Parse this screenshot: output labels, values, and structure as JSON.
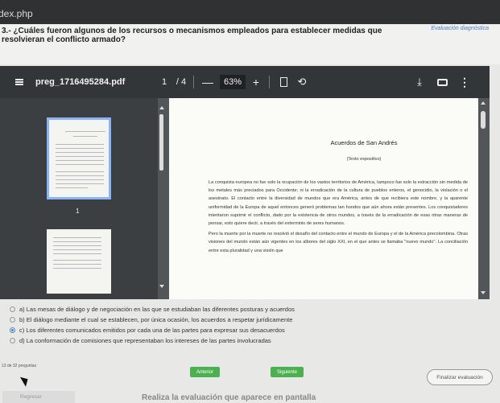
{
  "window": {
    "title": "dex.php"
  },
  "question": {
    "text": "3.- ¿Cuáles fueron algunos de los recursos o mecanismos empleados para establecer medidas que resolvieran el conflicto armado?",
    "eval_label": "Evaluación diagnóstica"
  },
  "pdf": {
    "filename": "preg_1716495284.pdf",
    "page_current": "1",
    "page_sep": "/ 4",
    "zoom": "63%",
    "zoom_minus": "—",
    "zoom_plus": "+",
    "thumb_page_number": "1",
    "doc_title": "Acuerdos de San Andrés",
    "doc_subtitle": "(Texto expositivo)",
    "paragraph1": "La conquista europea no fue solo la ocupación de los vastos territorios de América, tampoco fue solo la extracción sin medida de los metales más preciados para Occidente; ni la erradicación de la cultura de pueblos enteros, el genocidio, la violación o el asesinato. El contacto entre la diversidad de mundos que era América, antes de que recibiera este nombre, y la aparente uniformidad de la Europa de aquel entonces generó problemas tan hondos que aún ahora están presentes. Los conquistadores intentaron suprimir el conflicto, dado por la existencia de otros mundos, a través de la erradicación de esas otras maneras de pensar, esto quiere decir, a través del exterminio de seres humanos.",
    "paragraph2": "Pero la muerte por la muerte no resolvió el desafío del contacto entre el mundo de Europa y el de la América precolombina. Otras visiones del mundo están aún vigentes en los albores del siglo XXI, en el que antes se llamaba \"nuevo mundo\". La conciliación entre esta pluralidad y una visión que"
  },
  "options": [
    {
      "label": "a)  Las mesas de diálogo y de negociación en las que se estudiaban las diferentes posturas y acuerdos",
      "selected": false
    },
    {
      "label": "b)  El diálogo mediante el cual se establecen, por única ocasión, los acuerdos a respetar jurídicamente",
      "selected": false
    },
    {
      "label": "c)  Los diferentes comunicados emitidos por cada una de las partes para expresar sus desacuerdos",
      "selected": true
    },
    {
      "label": "d)  La conformación de comisiones que representaban los intereses de las partes involucradas",
      "selected": false
    }
  ],
  "footer": {
    "count": "13 de 32 preguntas",
    "prev": "Anterior",
    "next": "Siguiente",
    "finish": "Finalizar evaluación",
    "back": "Regresar",
    "bottom_text": "Realiza la evaluación que aparece en pantalla"
  }
}
